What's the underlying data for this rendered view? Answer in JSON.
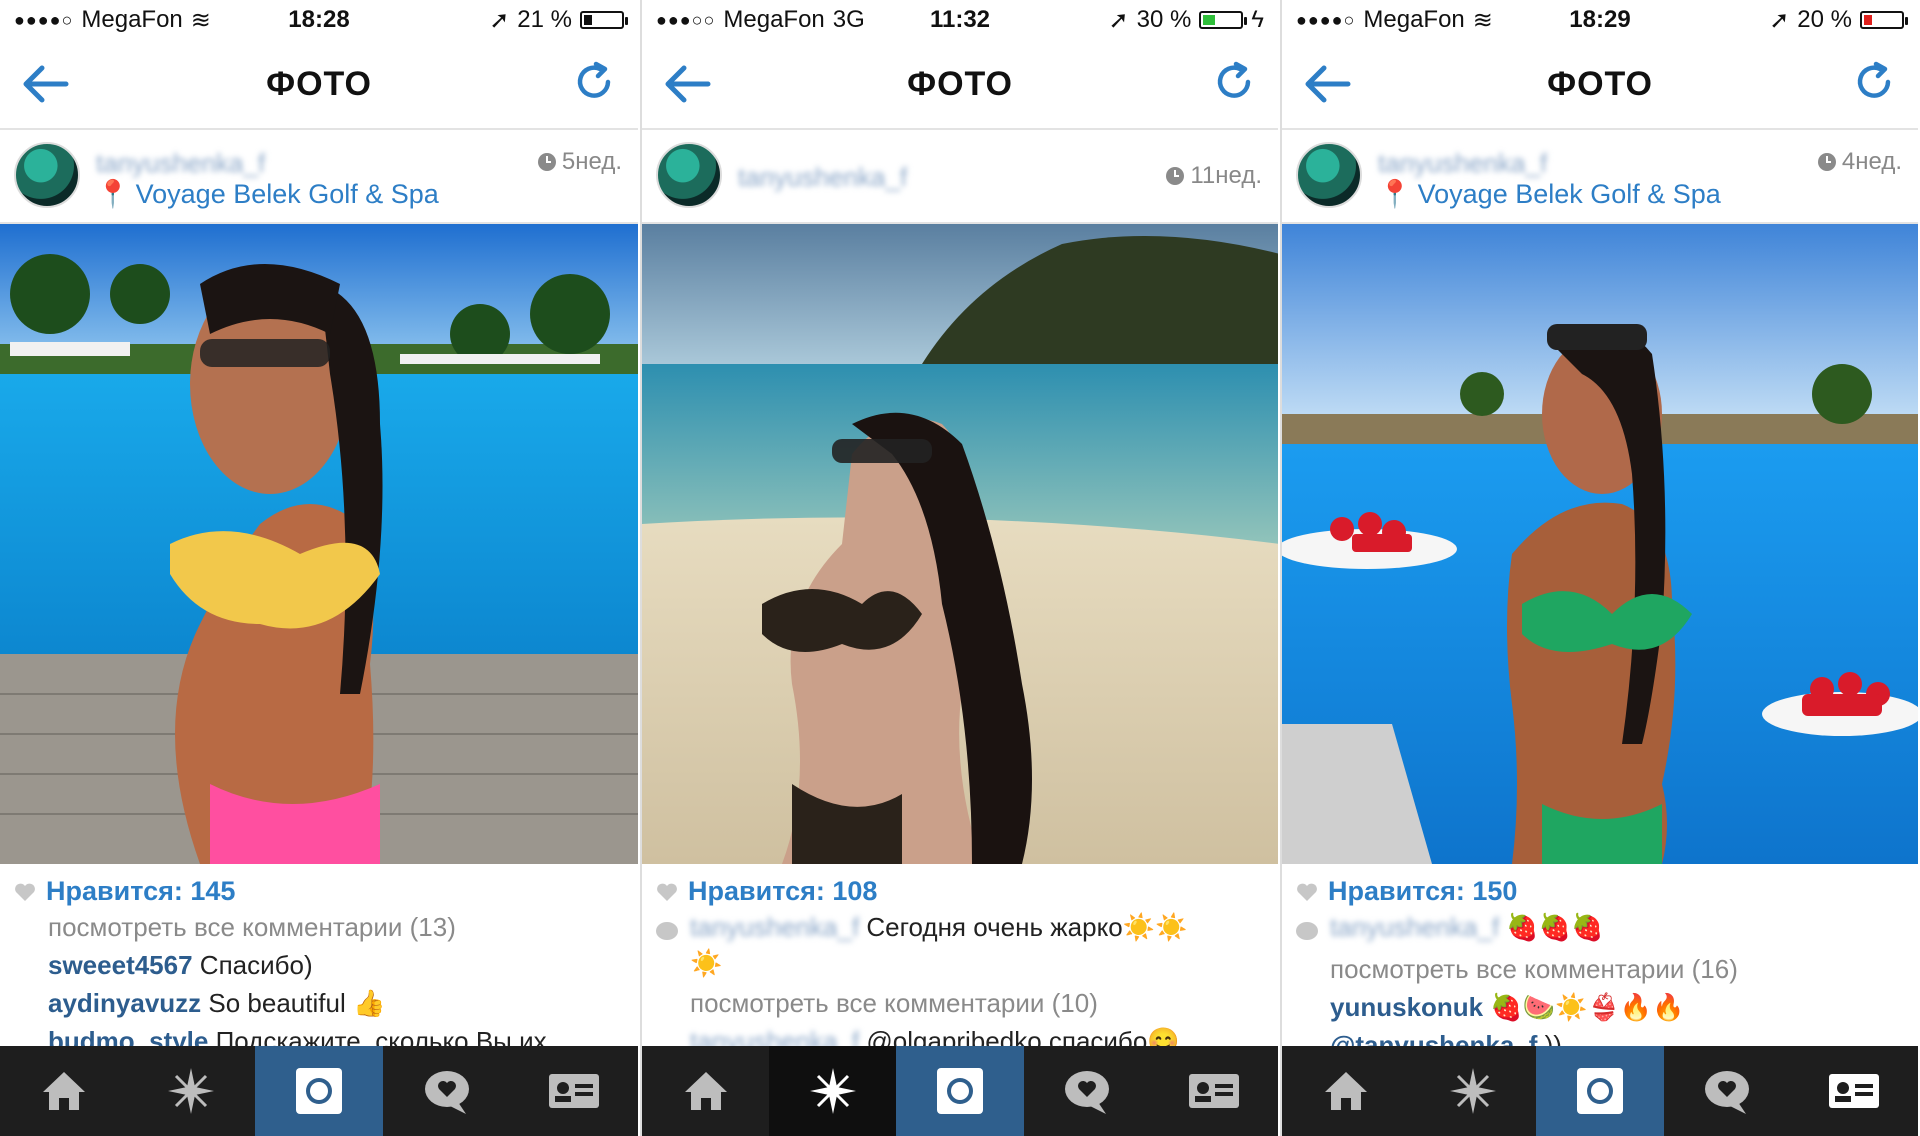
{
  "nav": {
    "title": "ФОТО"
  },
  "screens": [
    {
      "status": {
        "carrier": "MegaFon",
        "network": "",
        "time": "18:28",
        "battery": "21 %",
        "battery_level": 0.21,
        "battery_color": "#111111"
      },
      "post": {
        "username": "tanyushenka_f",
        "location": "Voyage Belek  Golf & Spa",
        "time_ago": "5нед.",
        "likes": "Нравится: 145",
        "comments": [
          {
            "type": "gray",
            "text": "посмотреть все комментарии (13)"
          },
          {
            "type": "comment",
            "user": "sweeet4567",
            "text": " Спасибо)"
          },
          {
            "type": "comment",
            "user": "aydinyavuzz",
            "text": " So beautiful 👍"
          },
          {
            "type": "comment",
            "user": "budmo_style",
            "text": " Подскажите, сколько Вы их"
          }
        ]
      },
      "active_tab": 2
    },
    {
      "status": {
        "carrier": "MegaFon",
        "network": "3G",
        "time": "11:32",
        "battery": "30 %",
        "battery_level": 0.3,
        "battery_color": "#2fbf3a"
      },
      "post": {
        "username": "tanyushenka_f",
        "location": "",
        "time_ago": "11нед.",
        "likes": "Нравится: 108",
        "comments": [
          {
            "type": "comment",
            "user": "tanyushenka_f",
            "text": " Сегодня очень жарко☀️☀️"
          },
          {
            "type": "plain",
            "text": "☀️"
          },
          {
            "type": "gray",
            "text": "посмотреть все комментарии (10)"
          },
          {
            "type": "comment",
            "user": "tanyushenka_f",
            "text": " @olgapribedko спасибо😊"
          }
        ]
      },
      "active_tab": 1
    },
    {
      "status": {
        "carrier": "MegaFon",
        "network": "",
        "time": "18:29",
        "battery": "20 %",
        "battery_level": 0.2,
        "battery_color": "#e0201c"
      },
      "post": {
        "username": "tanyushenka_f",
        "location": "Voyage Belek  Golf & Spa",
        "time_ago": "4нед.",
        "likes": "Нравится: 150",
        "comments": [
          {
            "type": "comment",
            "user": "tanyushenka_f",
            "text": " 🍓🍓🍓"
          },
          {
            "type": "gray",
            "text": "посмотреть все комментарии (16)"
          },
          {
            "type": "comment",
            "user": "yunuskonuk",
            "text": " 🍓🍉☀️👙🔥🔥"
          },
          {
            "type": "comment",
            "user": "@tanyushenka_f",
            "text": " ))"
          }
        ]
      },
      "active_tab": 2
    }
  ],
  "tabs": [
    "home-icon",
    "explore-icon",
    "camera-icon",
    "activity-icon",
    "profile-icon"
  ]
}
